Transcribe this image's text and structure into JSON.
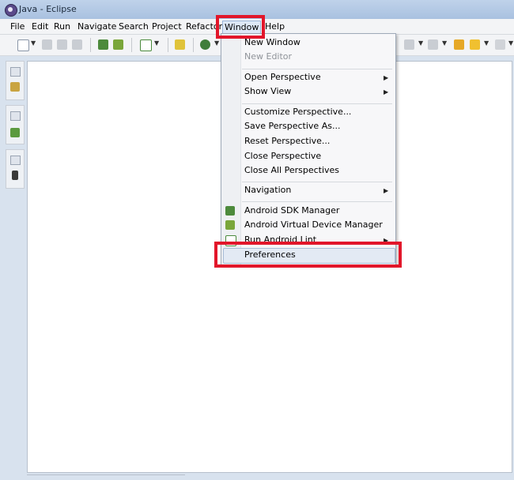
{
  "window": {
    "title": "Java - Eclipse"
  },
  "menubar": {
    "items": [
      "File",
      "Edit",
      "Run",
      "Navigate",
      "Search",
      "Project",
      "Refactor",
      "Window",
      "Help"
    ],
    "open_menu": "Window"
  },
  "window_menu": {
    "new_window": "New Window",
    "new_editor": "New Editor",
    "open_perspective": "Open Perspective",
    "show_view": "Show View",
    "customize_perspective": "Customize Perspective...",
    "save_perspective_as": "Save Perspective As...",
    "reset_perspective": "Reset Perspective...",
    "close_perspective": "Close Perspective",
    "close_all_perspectives": "Close All Perspectives",
    "navigation": "Navigation",
    "android_sdk_manager": "Android SDK Manager",
    "android_avd_manager": "Android Virtual Device Manager",
    "run_android_lint": "Run Android Lint",
    "preferences": "Preferences"
  },
  "colors": {
    "annotation_red": "#e2162a",
    "menu_highlight": "#e3eaf4"
  }
}
